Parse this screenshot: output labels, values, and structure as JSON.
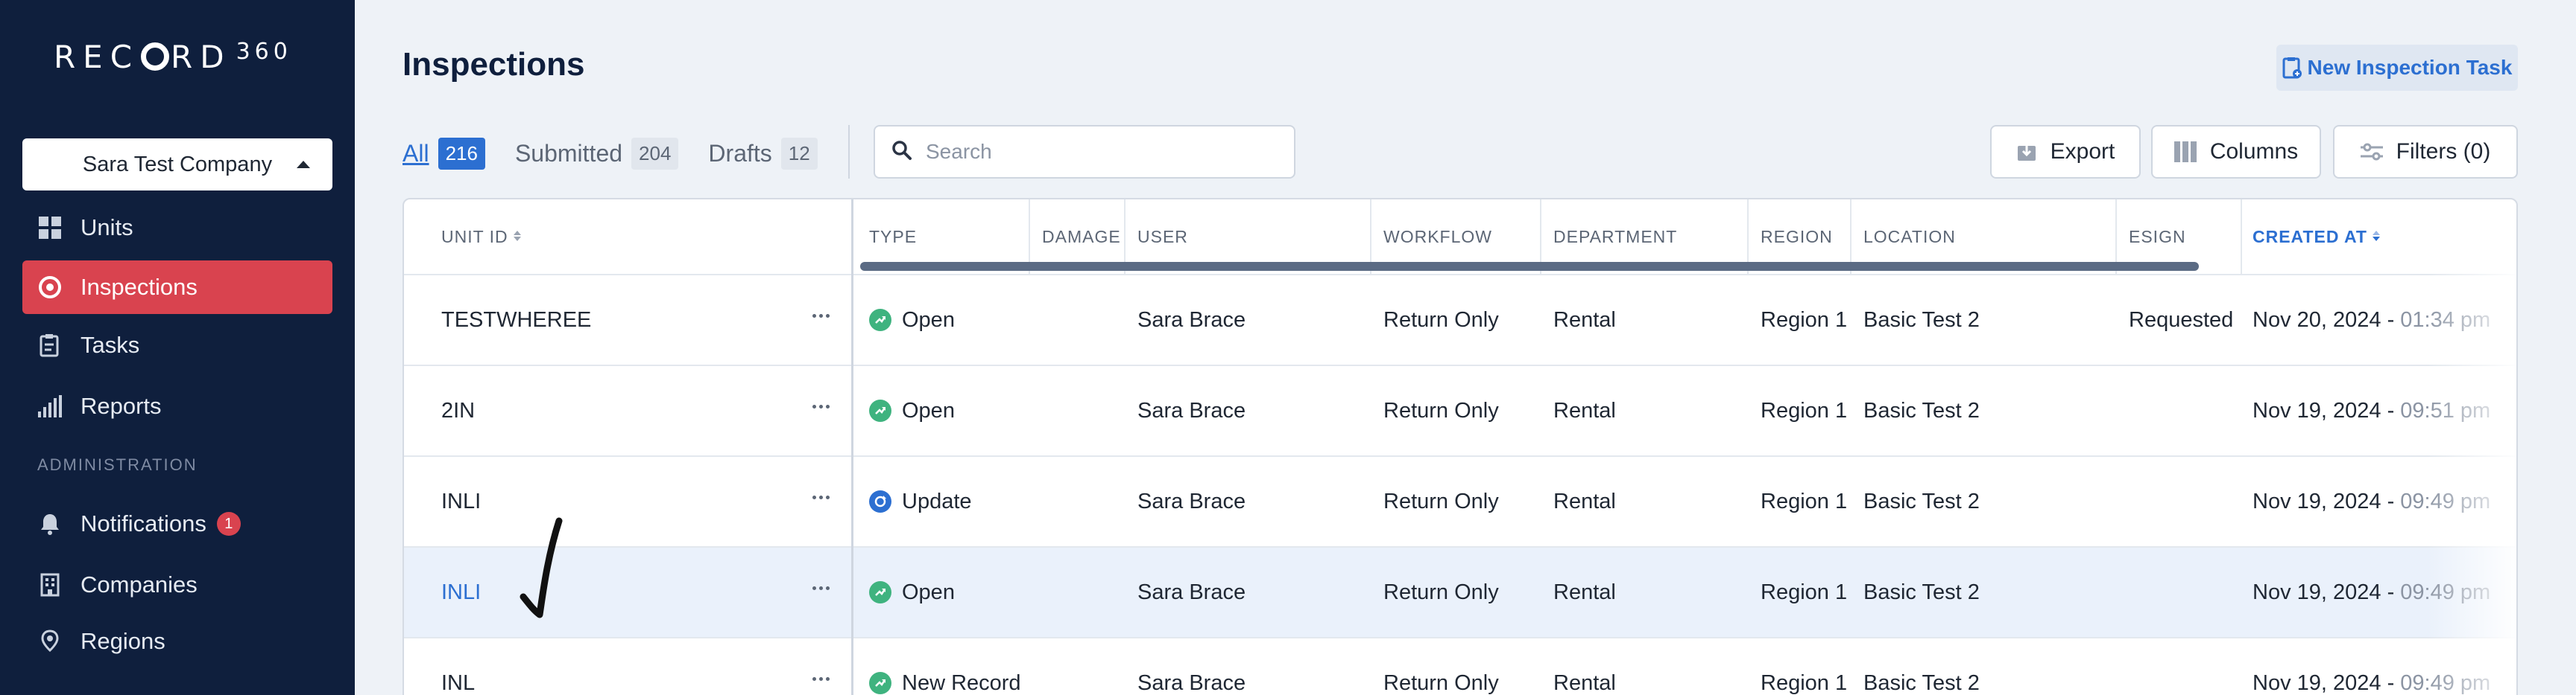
{
  "app": {
    "logo_text_a": "REC",
    "logo_text_b": "RD",
    "logo_num": "360",
    "company": "Sara Test Company"
  },
  "sidebar": {
    "items": [
      {
        "label": "Units",
        "icon": "grid-icon"
      },
      {
        "label": "Inspections",
        "icon": "target-icon",
        "active": true
      },
      {
        "label": "Tasks",
        "icon": "clipboard-icon"
      },
      {
        "label": "Reports",
        "icon": "bar-chart-icon"
      }
    ],
    "section_label": "ADMINISTRATION",
    "admin_items": [
      {
        "label": "Notifications",
        "icon": "bell-icon",
        "badge": "1"
      },
      {
        "label": "Companies",
        "icon": "building-icon"
      },
      {
        "label": "Regions",
        "icon": "map-pin-icon"
      }
    ]
  },
  "header": {
    "title": "Inspections",
    "new_task_label": "New Inspection Task"
  },
  "tabs": [
    {
      "label": "All",
      "count": "216",
      "active": true
    },
    {
      "label": "Submitted",
      "count": "204"
    },
    {
      "label": "Drafts",
      "count": "12"
    }
  ],
  "search": {
    "placeholder": "Search",
    "value": ""
  },
  "toolbar": {
    "export_label": "Export",
    "columns_label": "Columns",
    "filters_label": "Filters (0)"
  },
  "table": {
    "columns": [
      "UNIT ID",
      "TYPE",
      "DAMAGE",
      "USER",
      "WORKFLOW",
      "DEPARTMENT",
      "REGION",
      "LOCATION",
      "ESIGN",
      "CREATED AT"
    ],
    "rows": [
      {
        "unit_id": "TESTWHEREE",
        "type": "Open",
        "damage": "",
        "user": "Sara Brace",
        "workflow": "Return Only",
        "department": "Rental",
        "region": "Region 1",
        "location": "Basic Test 2",
        "esign": "Requested",
        "created_date": "Nov 20, 2024 - ",
        "created_time": "01:34 pm"
      },
      {
        "unit_id": "2IN",
        "type": "Open",
        "damage": "",
        "user": "Sara Brace",
        "workflow": "Return Only",
        "department": "Rental",
        "region": "Region 1",
        "location": "Basic Test 2",
        "esign": "",
        "created_date": "Nov 19, 2024 - ",
        "created_time": "09:51 pm"
      },
      {
        "unit_id": "INLI",
        "type": "Update",
        "damage": "",
        "user": "Sara Brace",
        "workflow": "Return Only",
        "department": "Rental",
        "region": "Region 1",
        "location": "Basic Test 2",
        "esign": "",
        "created_date": "Nov 19, 2024 - ",
        "created_time": "09:49 pm"
      },
      {
        "unit_id": "INLI",
        "type": "Open",
        "damage": "",
        "user": "Sara Brace",
        "workflow": "Return Only",
        "department": "Rental",
        "region": "Region 1",
        "location": "Basic Test 2",
        "esign": "",
        "created_date": "Nov 19, 2024 - ",
        "created_time": "09:49 pm"
      },
      {
        "unit_id": "INL",
        "type": "New Record",
        "damage": "",
        "user": "Sara Brace",
        "workflow": "Return Only",
        "department": "Rental",
        "region": "Region 1",
        "location": "Basic Test 2",
        "esign": "",
        "created_date": "Nov 19, 2024 - ",
        "created_time": "09:49 pm"
      }
    ]
  },
  "colors": {
    "sidebar_bg": "#0f1f3d",
    "accent": "#2c6fd1",
    "active_nav": "#d9434f",
    "status_open": "#3fb37f",
    "status_update": "#2c6fd1"
  }
}
